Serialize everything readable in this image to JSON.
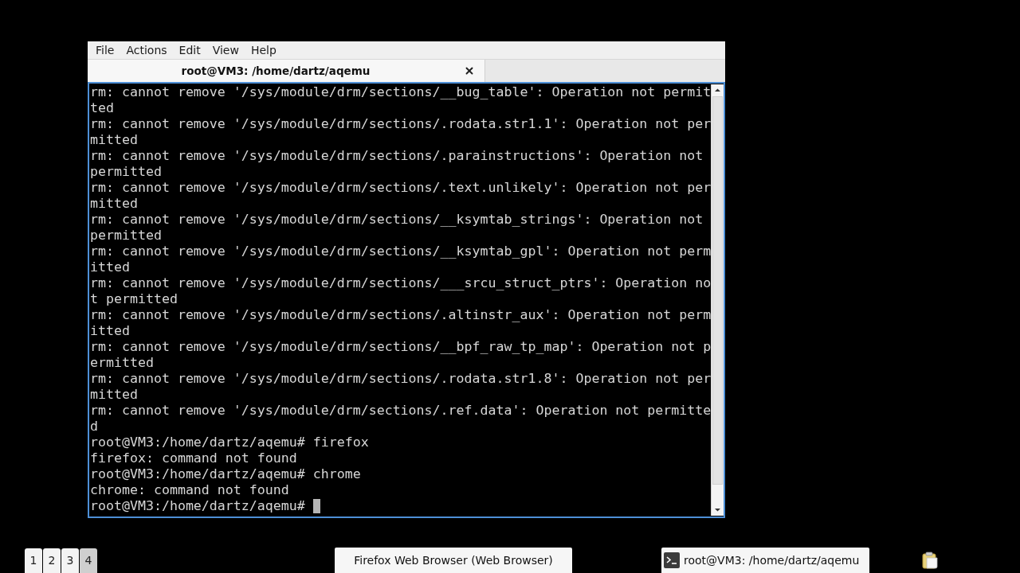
{
  "window": {
    "menu": [
      "File",
      "Actions",
      "Edit",
      "View",
      "Help"
    ],
    "tabs": [
      {
        "label": "root@VM3: /home/dartz/aqemu",
        "selected": true
      }
    ],
    "terminal": {
      "lines": [
        "rm: cannot remove '/sys/module/drm/sections/__bug_table': Operation not permit",
        "ted",
        "rm: cannot remove '/sys/module/drm/sections/.rodata.str1.1': Operation not per",
        "mitted",
        "rm: cannot remove '/sys/module/drm/sections/.parainstructions': Operation not",
        "permitted",
        "rm: cannot remove '/sys/module/drm/sections/.text.unlikely': Operation not per",
        "mitted",
        "rm: cannot remove '/sys/module/drm/sections/__ksymtab_strings': Operation not",
        "permitted",
        "rm: cannot remove '/sys/module/drm/sections/__ksymtab_gpl': Operation not perm",
        "itted",
        "rm: cannot remove '/sys/module/drm/sections/___srcu_struct_ptrs': Operation no",
        "t permitted",
        "rm: cannot remove '/sys/module/drm/sections/.altinstr_aux': Operation not perm",
        "itted",
        "rm: cannot remove '/sys/module/drm/sections/__bpf_raw_tp_map': Operation not p",
        "ermitted",
        "rm: cannot remove '/sys/module/drm/sections/.rodata.str1.8': Operation not per",
        "mitted",
        "rm: cannot remove '/sys/module/drm/sections/.ref.data': Operation not permitte",
        "d",
        "root@VM3:/home/dartz/aqemu# firefox",
        "firefox: command not found",
        "root@VM3:/home/dartz/aqemu# chrome",
        "chrome: command not found"
      ],
      "prompt": "root@VM3:/home/dartz/aqemu#"
    }
  },
  "taskbar": {
    "workspaces": [
      {
        "label": "1",
        "selected": false
      },
      {
        "label": "2",
        "selected": false
      },
      {
        "label": "3",
        "selected": false
      },
      {
        "label": "4",
        "selected": true
      }
    ],
    "tasks": [
      {
        "label": "Firefox Web Browser (Web Browser)",
        "kind": "plain"
      },
      {
        "label": "root@VM3: /home/dartz/aqemu",
        "kind": "terminal"
      }
    ]
  }
}
